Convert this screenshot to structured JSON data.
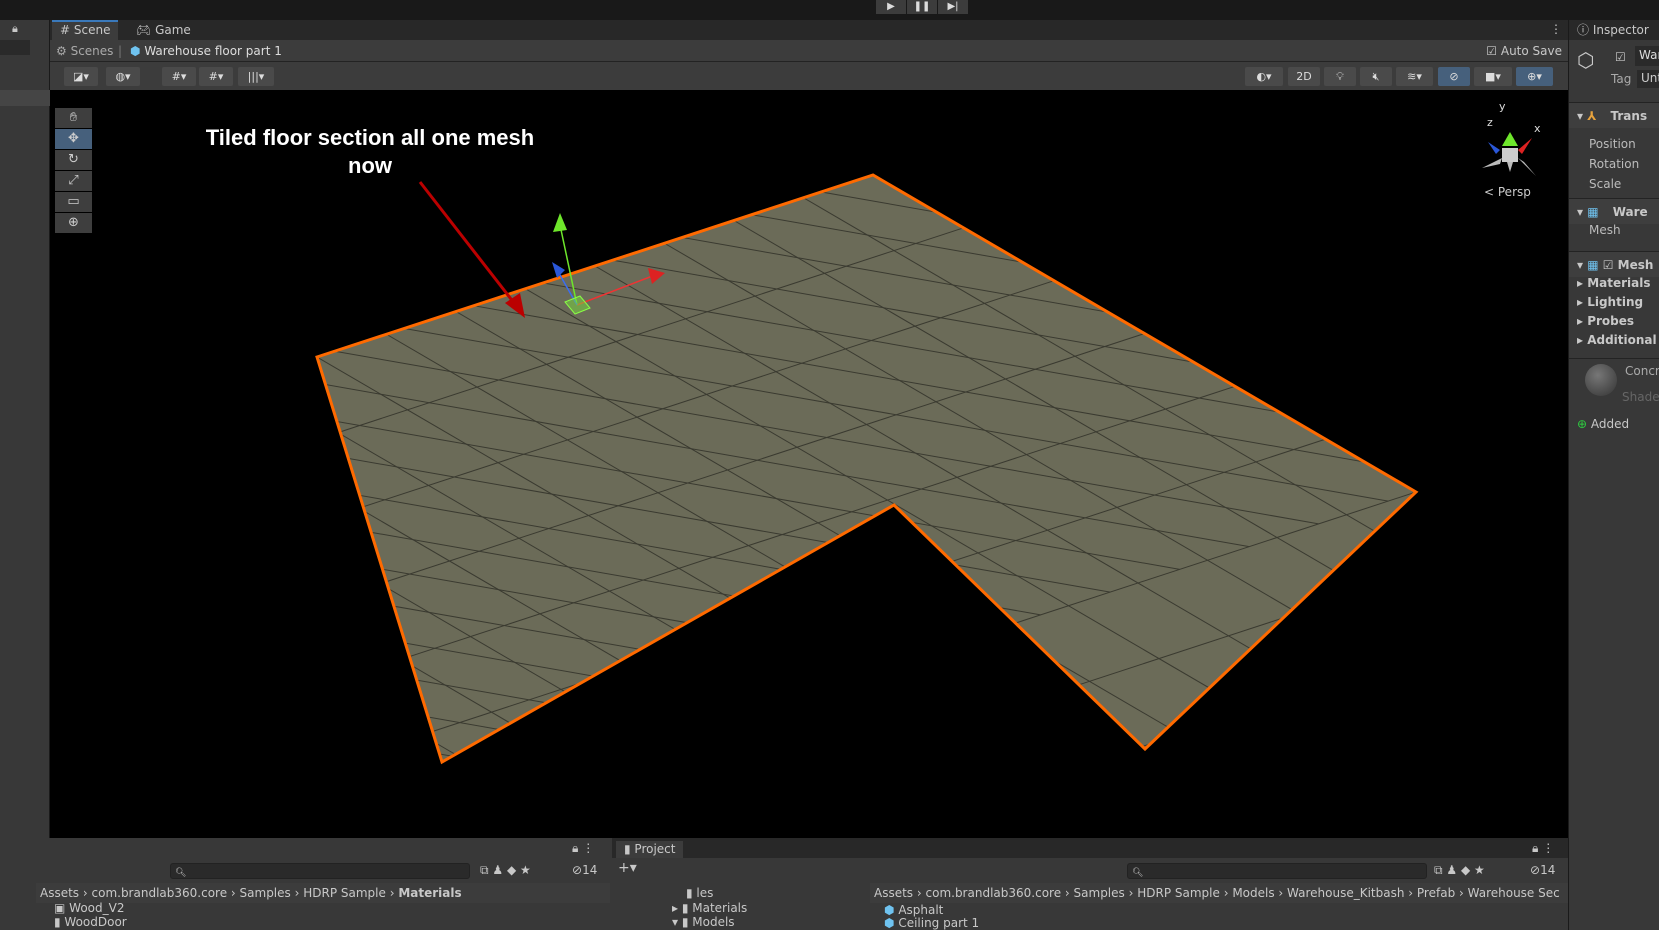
{
  "playbar": {
    "play": "▶",
    "pause": "❚❚",
    "step": "▶|"
  },
  "tabs": [
    {
      "label": "Scene",
      "icon": "grid-icon"
    },
    {
      "label": "Game",
      "icon": "gamepad-icon"
    }
  ],
  "breadcrumb": {
    "root": "Scenes",
    "current": "Warehouse floor part 1"
  },
  "auto_save": {
    "label": "Auto Save",
    "checked": true
  },
  "toolbar_right": {
    "two_d": "2D"
  },
  "viewport": {
    "projection": "Persp",
    "gizmo_axes": [
      "y",
      "z",
      "x"
    ],
    "annotation": "Tiled floor section all one mesh now",
    "outline_color": "#ff6a00",
    "floor_color": "#6b6b58"
  },
  "tools": [
    "hand",
    "move",
    "rotate",
    "scale",
    "rect",
    "transform"
  ],
  "inspector": {
    "title": "Inspector",
    "object_name": "War",
    "tag_label": "Tag",
    "tag_value": "Unt",
    "transform": {
      "title": "Trans",
      "fields": [
        "Position",
        "Rotation",
        "Scale"
      ]
    },
    "mesh_filter": {
      "title": "Ware",
      "field": "Mesh"
    },
    "mesh_renderer": {
      "title": "Mesh",
      "sections": [
        "Materials",
        "Lighting",
        "Probes",
        "Additional S"
      ]
    },
    "material": {
      "name": "Concr",
      "shader": "Shader"
    },
    "added": "Added"
  },
  "bottom_left": {
    "hidden_count": "14",
    "breadcrumb": [
      "Assets",
      "com.brandlab360.core",
      "Samples",
      "HDRP Sample",
      "Materials"
    ],
    "items": [
      "Wood_V2",
      "WoodDoor"
    ]
  },
  "project": {
    "tab": "Project",
    "hidden_count": "14",
    "tree": [
      "les",
      "Materials",
      "Models"
    ],
    "breadcrumb": [
      "Assets",
      "com.brandlab360.core",
      "Samples",
      "HDRP Sample",
      "Models",
      "Warehouse_Kitbash",
      "Prefab",
      "Warehouse Sec"
    ],
    "items": [
      "Asphalt",
      "Ceiling part 1"
    ]
  }
}
